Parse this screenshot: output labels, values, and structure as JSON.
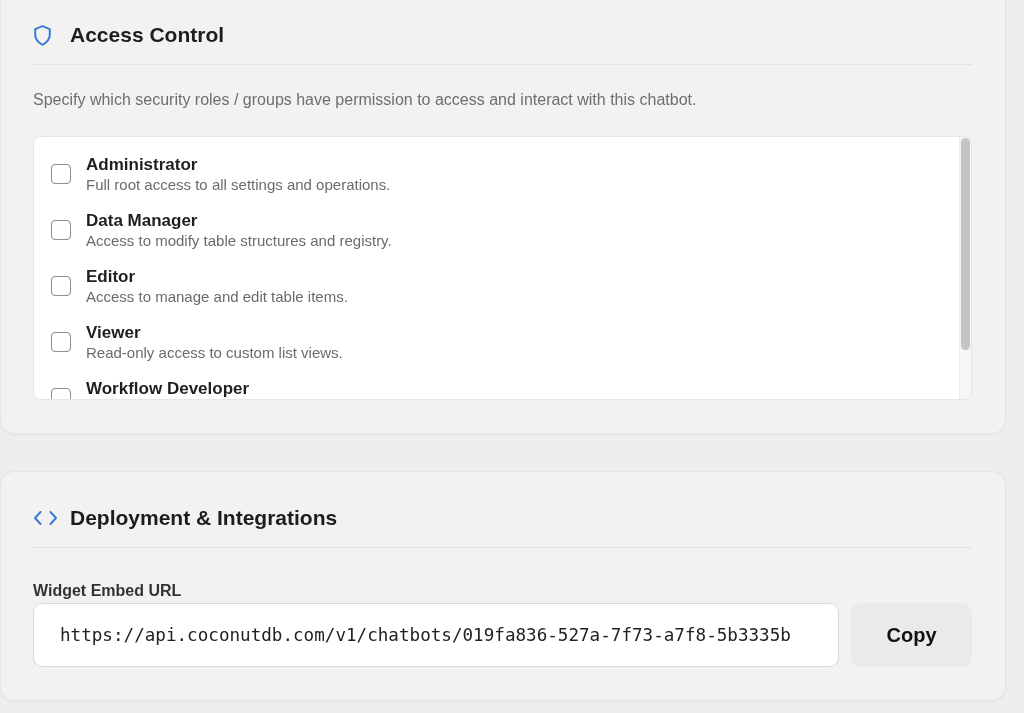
{
  "access_control": {
    "title": "Access Control",
    "description": "Specify which security roles / groups have permission to access and interact with this chatbot.",
    "roles": [
      {
        "name": "Administrator",
        "description": "Full root access to all settings and operations.",
        "checked": false
      },
      {
        "name": "Data Manager",
        "description": "Access to modify table structures and registry.",
        "checked": false
      },
      {
        "name": "Editor",
        "description": "Access to manage and edit table items.",
        "checked": false
      },
      {
        "name": "Viewer",
        "description": "Read-only access to custom list views.",
        "checked": false
      },
      {
        "name": "Workflow Developer",
        "checked": false
      }
    ]
  },
  "deployment": {
    "title": "Deployment & Integrations",
    "widget_embed_url": {
      "label": "Widget Embed URL",
      "value": "https://api.coconutdb.com/v1/chatbots/019fa836-527a-7f73-a7f8-5b3335b"
    },
    "copy_button": "Copy"
  }
}
